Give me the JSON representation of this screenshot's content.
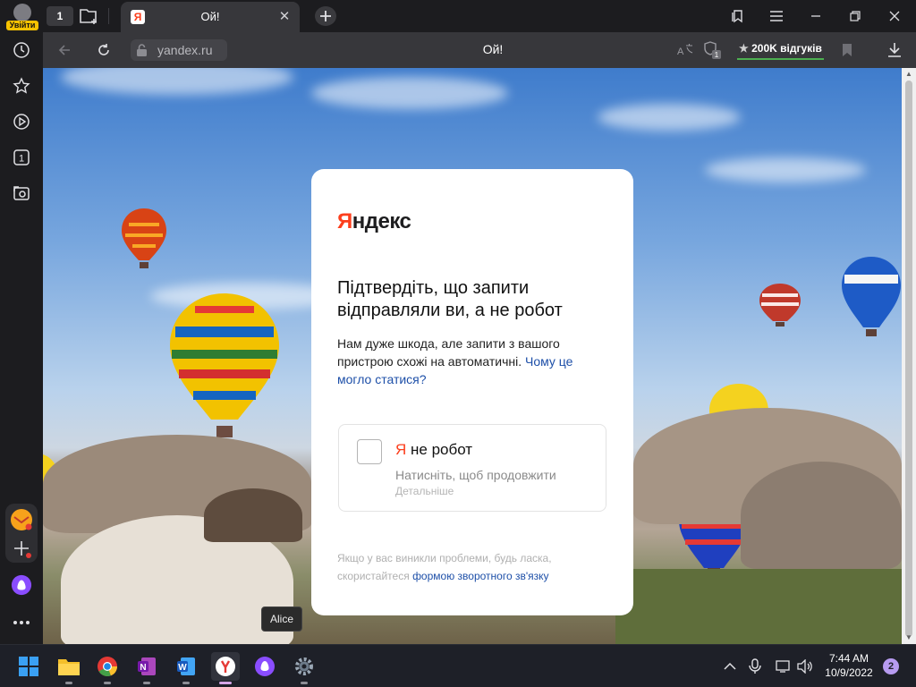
{
  "browser": {
    "profile_badge": "Увійти",
    "tab_count": "1",
    "active_tab": {
      "title": "Ой!",
      "favicon_letter": "Я",
      "close": "✕"
    },
    "address": {
      "url": "yandex.ru",
      "page_title": "Ой!"
    },
    "reviews": {
      "star": "★",
      "label": "200K відгуків"
    },
    "protect_badge": "1",
    "side_tab_count": "1"
  },
  "captcha": {
    "logo_first": "Я",
    "logo_rest": "ндекс",
    "heading": "Підтвердіть, що запити відправляли ви, а не робот",
    "description": "Нам дуже шкода, але запити з вашого пристрою схожі на автоматичні.",
    "why_link": "Чому це могло статися?",
    "checkbox_label_ya": "Я",
    "checkbox_label_rest": " не робот",
    "checkbox_hint": "Натисніть, щоб продовжити",
    "checkbox_more": "Детальніше",
    "footer_text": "Якщо у вас виникли проблеми, будь ласка, скористайтеся",
    "footer_link": "формою зворотного зв'язку"
  },
  "tooltip": {
    "alice": "Alice"
  },
  "taskbar": {
    "time": "7:44 AM",
    "date": "10/9/2022",
    "notifications": "2"
  },
  "colors": {
    "yandex_red": "#fc3f1d",
    "link_blue": "#1d4fa8",
    "alice_purple": "#8a4dff",
    "reviews_underline": "#4caf50"
  }
}
